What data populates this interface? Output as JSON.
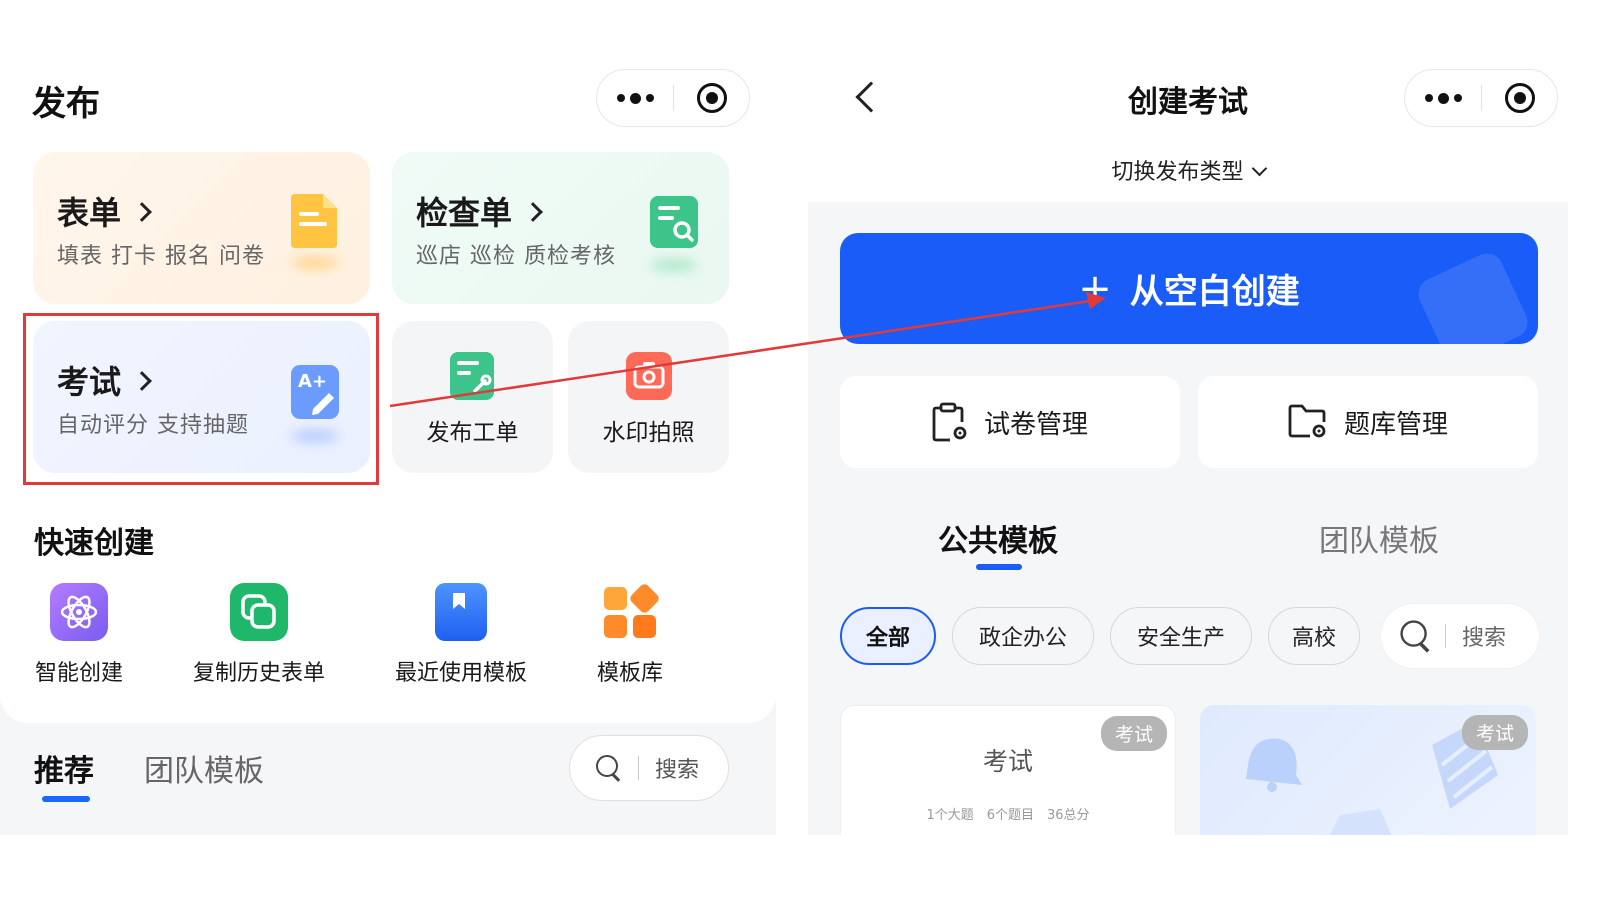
{
  "left": {
    "title": "发布",
    "cards": {
      "form": {
        "title": "表单",
        "subtitle": "填表 打卡 报名 问卷"
      },
      "checklist": {
        "title": "检查单",
        "subtitle": "巡店 巡检 质检考核"
      },
      "exam": {
        "title": "考试",
        "subtitle": "自动评分 支持抽题"
      },
      "work_order": {
        "label": "发布工单"
      },
      "watermark_photo": {
        "label": "水印拍照"
      }
    },
    "quick_create": {
      "title": "快速创建",
      "items": [
        {
          "label": "智能创建",
          "icon": "atom-icon",
          "color": "#9b6cf5"
        },
        {
          "label": "复制历史表单",
          "icon": "copy-icon",
          "color": "#1fb86b"
        },
        {
          "label": "最近使用模板",
          "icon": "bookmark-icon",
          "color": "#2f7cf6"
        },
        {
          "label": "模板库",
          "icon": "grid-icon",
          "color": "#ff8a2a"
        }
      ]
    },
    "tabs": [
      "推荐",
      "团队模板"
    ],
    "search_label": "搜索"
  },
  "right": {
    "title": "创建考试",
    "switch_type": "切换发布类型",
    "create_blank": "从空白创建",
    "manage": [
      "试卷管理",
      "题库管理"
    ],
    "tabs": [
      "公共模板",
      "团队模板"
    ],
    "chips": [
      "全部",
      "政企办公",
      "安全生产",
      "高校"
    ],
    "search_label": "搜索",
    "templates": [
      {
        "badge": "考试",
        "title": "考试",
        "meta": "1个大题　6个题目　36总分"
      },
      {
        "badge": "考试"
      }
    ]
  },
  "colors": {
    "accent": "#1a5cf7",
    "highlight": "#e13a3a"
  }
}
